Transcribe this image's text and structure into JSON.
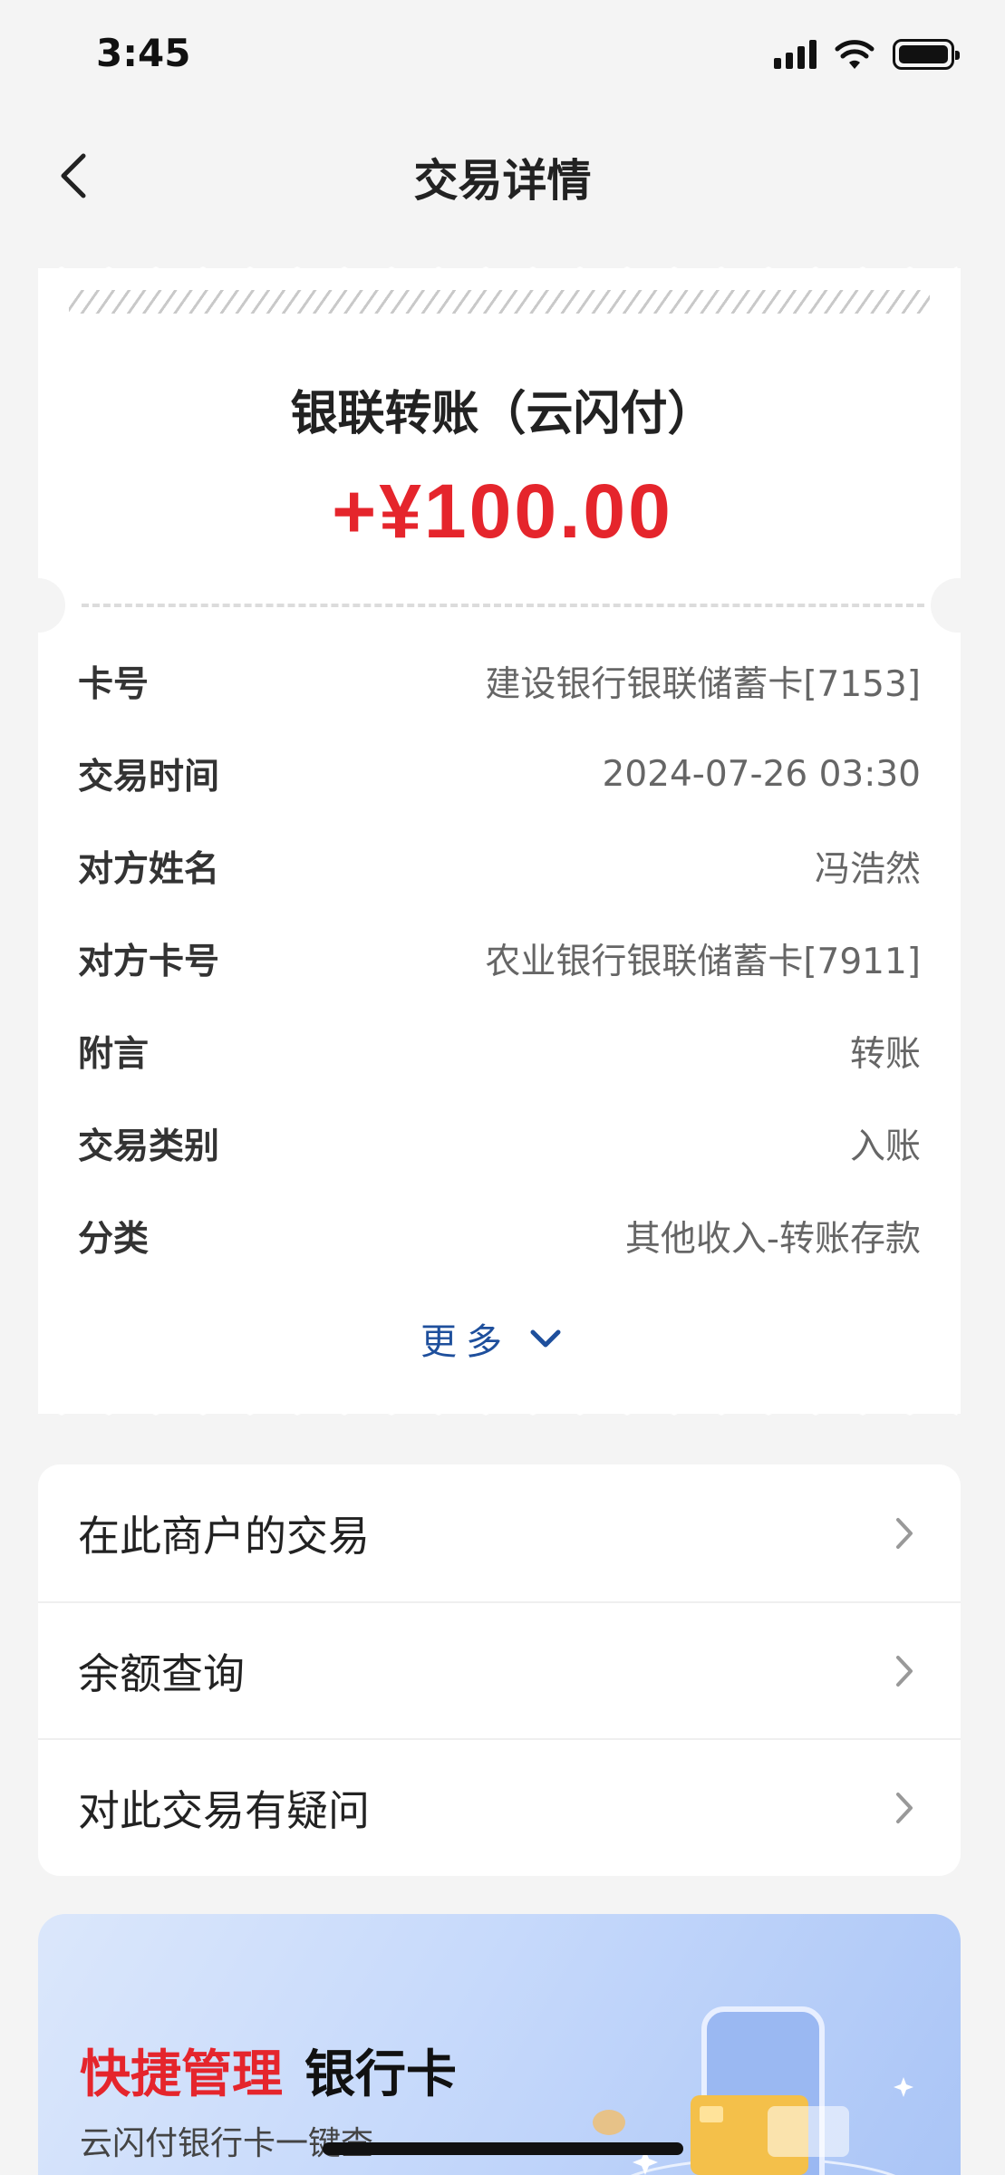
{
  "status_bar": {
    "time": "3:45"
  },
  "nav": {
    "title": "交易详情"
  },
  "receipt": {
    "title": "银联转账（云闪付）",
    "amount": "+¥100.00",
    "amount_color": "#e5252c",
    "rows": [
      {
        "label": "卡号",
        "value": "建设银行银联储蓄卡[7153]"
      },
      {
        "label": "交易时间",
        "value": "2024-07-26 03:30"
      },
      {
        "label": "对方姓名",
        "value": "冯浩然"
      },
      {
        "label": "对方卡号",
        "value": "农业银行银联储蓄卡[7911]"
      },
      {
        "label": "附言",
        "value": "转账"
      },
      {
        "label": "交易类别",
        "value": "入账"
      },
      {
        "label": "分类",
        "value": "其他收入-转账存款"
      }
    ],
    "more_label": "更多"
  },
  "menu": [
    {
      "label": "在此商户的交易"
    },
    {
      "label": "余额查询"
    },
    {
      "label": "对此交易有疑问"
    }
  ],
  "banner": {
    "title_red": "快捷管理",
    "title_dark": "银行卡",
    "subtitle": "云闪付银行卡一键查"
  },
  "icons": {
    "back": "chevron-left-icon",
    "more": "chevron-down-icon",
    "menu_arrow": "chevron-right-icon"
  },
  "colors": {
    "accent_red": "#e5252c",
    "link_blue": "#1e4f9c",
    "background": "#f4f4f4"
  }
}
